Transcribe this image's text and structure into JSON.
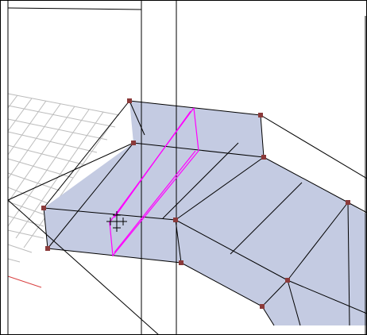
{
  "viewport": {
    "background_color": "#ffffff",
    "border_color": "#000000"
  },
  "colors": {
    "face_fill": "#c4cbe2",
    "edge": "#000000",
    "vertex": "#8b3a3a",
    "selection_loop": "#ff00ff",
    "grid": "#bcbcbc",
    "axis_x": "#d94040",
    "cursor": "#000000"
  },
  "cursor": {
    "icon": "move-crosshair-cursor-icon"
  }
}
